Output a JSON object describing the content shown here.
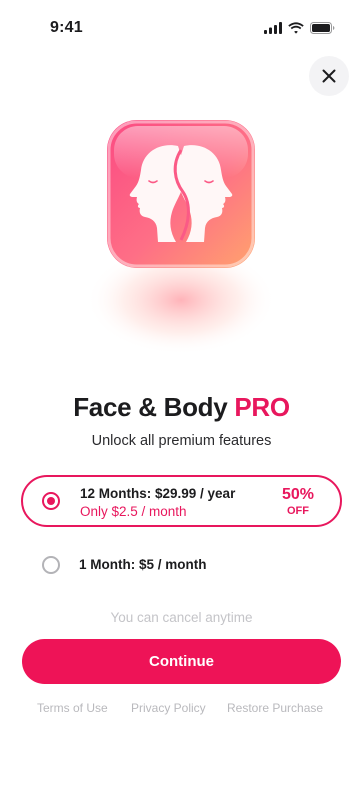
{
  "status_bar": {
    "time": "9:41"
  },
  "title": {
    "main": "Face & Body",
    "accent": "PRO"
  },
  "subtitle": "Unlock all premium features",
  "plans": [
    {
      "main": "12 Months: $29.99 / year",
      "sub": "Only $2.5 / month",
      "discount_pct": "50%",
      "discount_off": "OFF",
      "selected": true
    },
    {
      "main": "1 Month: $5 / month",
      "selected": false
    }
  ],
  "cancel_note": "You can cancel anytime",
  "continue_label": "Continue",
  "footer": {
    "terms": "Terms of Use",
    "privacy": "Privacy Policy",
    "restore": "Restore Purchase"
  },
  "colors": {
    "accent": "#e8175d",
    "button": "#ee1357"
  },
  "icons": [
    "signal-icon",
    "wifi-icon",
    "battery-icon",
    "close-icon",
    "face-silhouettes-icon"
  ]
}
